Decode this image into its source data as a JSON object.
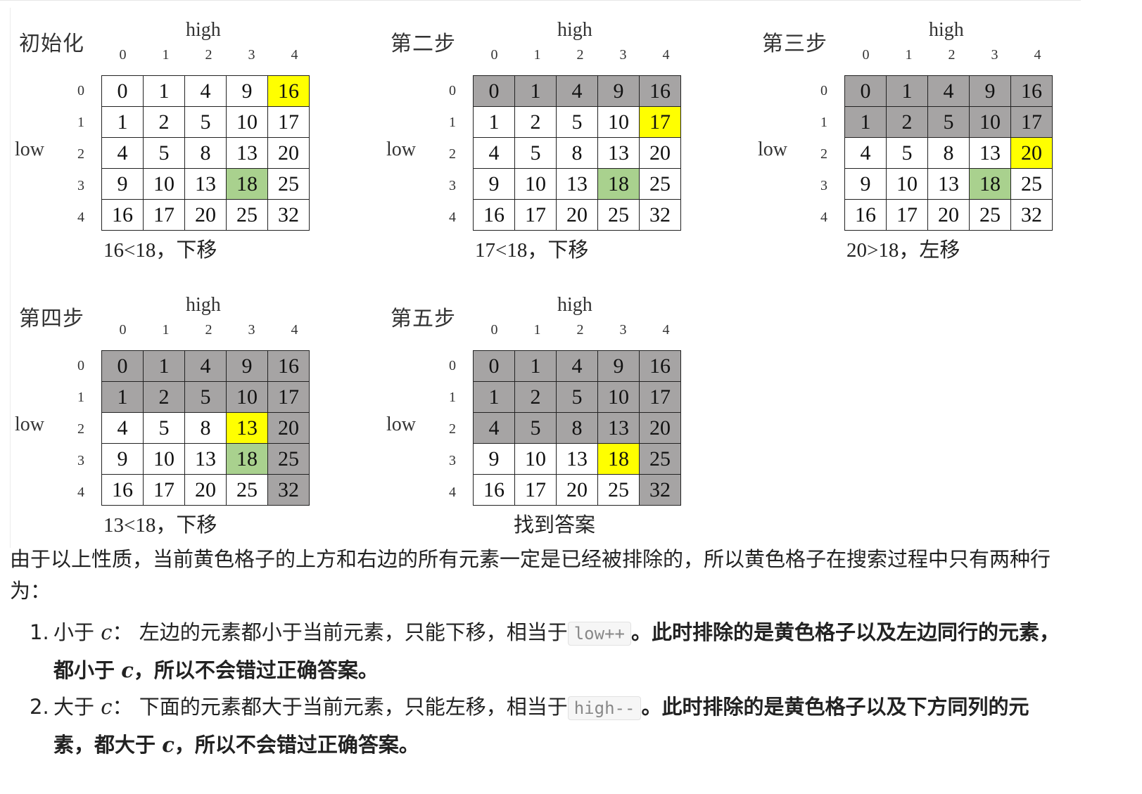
{
  "axis": {
    "high_label": "high",
    "low_label": "low",
    "col_numbers": [
      "0",
      "1",
      "2",
      "3",
      "4"
    ],
    "row_numbers": [
      "0",
      "1",
      "2",
      "3",
      "4"
    ]
  },
  "matrix": [
    [
      "0",
      "1",
      "4",
      "9",
      "16"
    ],
    [
      "1",
      "2",
      "5",
      "10",
      "17"
    ],
    [
      "4",
      "5",
      "8",
      "13",
      "20"
    ],
    [
      "9",
      "10",
      "13",
      "18",
      "25"
    ],
    [
      "16",
      "17",
      "20",
      "25",
      "32"
    ]
  ],
  "panels": [
    {
      "title": "初始化",
      "caption": "16<18，下移",
      "shade": [
        [
          0,
          0,
          0,
          0,
          "y"
        ],
        [
          0,
          0,
          0,
          0,
          0
        ],
        [
          0,
          0,
          0,
          0,
          0
        ],
        [
          0,
          0,
          0,
          "t",
          0
        ],
        [
          0,
          0,
          0,
          0,
          0
        ]
      ]
    },
    {
      "title": "第二步",
      "caption": "17<18，下移",
      "shade": [
        [
          "g",
          "g",
          "g",
          "g",
          "g"
        ],
        [
          0,
          0,
          0,
          0,
          "y"
        ],
        [
          0,
          0,
          0,
          0,
          0
        ],
        [
          0,
          0,
          0,
          "t",
          0
        ],
        [
          0,
          0,
          0,
          0,
          0
        ]
      ]
    },
    {
      "title": "第三步",
      "caption": "20>18，左移",
      "shade": [
        [
          "g",
          "g",
          "g",
          "g",
          "g"
        ],
        [
          "g",
          "g",
          "g",
          "g",
          "g"
        ],
        [
          0,
          0,
          0,
          0,
          "y"
        ],
        [
          0,
          0,
          0,
          "t",
          0
        ],
        [
          0,
          0,
          0,
          0,
          0
        ]
      ]
    },
    {
      "title": "第四步",
      "caption": "13<18，下移",
      "shade": [
        [
          "g",
          "g",
          "g",
          "g",
          "g"
        ],
        [
          "g",
          "g",
          "g",
          "g",
          "g"
        ],
        [
          0,
          0,
          0,
          "y",
          "g"
        ],
        [
          0,
          0,
          0,
          "t",
          "g"
        ],
        [
          0,
          0,
          0,
          0,
          "g"
        ]
      ]
    },
    {
      "title": "第五步",
      "caption": "找到答案",
      "shade": [
        [
          "g",
          "g",
          "g",
          "g",
          "g"
        ],
        [
          "g",
          "g",
          "g",
          "g",
          "g"
        ],
        [
          "g",
          "g",
          "g",
          "g",
          "g"
        ],
        [
          0,
          0,
          0,
          "y",
          "g"
        ],
        [
          0,
          0,
          0,
          0,
          "g"
        ]
      ]
    }
  ],
  "colors": {
    "excluded": "#a6a4a4",
    "current": "#ffff00",
    "target": "#a9d18e"
  },
  "text": {
    "paragraph": "由于以上性质，当前黄色格子的上方和右边的所有元素一定是已经被排除的，所以黄色格子在搜索过程中只有两种行为：",
    "items": [
      {
        "num": "1.",
        "lead": "小于",
        "var": "c",
        "colon": "：",
        "desc": "左边的元素都小于当前元素，只能下移，相当于",
        "code": "low++",
        "bold_a": "。此时排除的是黄色格子以及左边同行的元素，都小于",
        "bold_var": "c",
        "bold_b": "，所以不会错过正确答案。"
      },
      {
        "num": "2.",
        "lead": "大于",
        "var": "c",
        "colon": "：",
        "desc": "下面的元素都大于当前元素，只能左移，相当于",
        "code": "high--",
        "bold_a": "。此时排除的是黄色格子以及下方同列的元素，都大于",
        "bold_var": "c",
        "bold_b": "，所以不会错过正确答案。"
      }
    ]
  }
}
